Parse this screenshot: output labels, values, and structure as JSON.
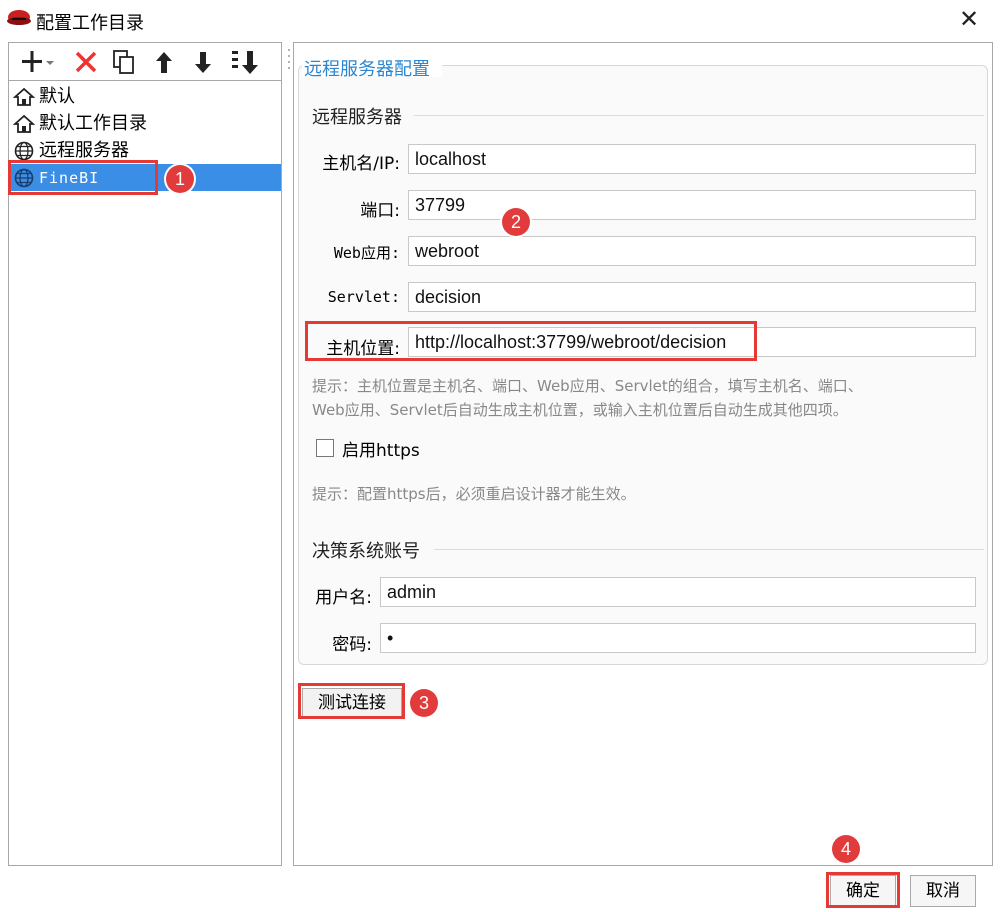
{
  "window": {
    "title": "配置工作目录",
    "close_glyph": "✕"
  },
  "toolbar": {
    "icons": [
      "add-dropdown-icon",
      "delete-icon",
      "copy-icon",
      "arrow-up-icon",
      "arrow-down-icon",
      "sort-icon"
    ]
  },
  "tree": {
    "items": [
      {
        "label": "默认",
        "icon": "home-icon"
      },
      {
        "label": "默认工作目录",
        "icon": "home-icon"
      },
      {
        "label": "远程服务器",
        "icon": "globe-icon"
      },
      {
        "label": "FineBI",
        "icon": "globe-icon",
        "selected": true
      }
    ]
  },
  "panel": {
    "section_title": "远程服务器配置",
    "remote_server_title": "远程服务器",
    "fields": {
      "hostname_label": "主机名/IP:",
      "hostname_value": "localhost",
      "port_label": "端口:",
      "port_value": "37799",
      "webapp_label": "Web应用:",
      "webapp_value": "webroot",
      "servlet_label": "Servlet:",
      "servlet_value": "decision",
      "host_location_label": "主机位置:",
      "host_location_value": "http://localhost:37799/webroot/decision"
    },
    "hint1_line1": "提示：主机位置是主机名、端口、Web应用、Servlet的组合，填写主机名、端口、",
    "hint1_line2": "Web应用、Servlet后自动生成主机位置，或输入主机位置后自动生成其他四项。",
    "https_label": "启用https",
    "https_checked": false,
    "hint2": "提示：配置https后，必须重启设计器才能生效。",
    "account_title": "决策系统账号",
    "username_label": "用户名:",
    "username_value": "admin",
    "password_label": "密码:",
    "password_value": "•",
    "test_button": "测试连接"
  },
  "footer": {
    "ok_button": "确定",
    "cancel_button": "取消"
  },
  "annotations": {
    "badges": [
      "1",
      "2",
      "3",
      "4"
    ],
    "badge_color": "#e23b3b",
    "highlight_color": "#e53935",
    "selection_color": "#3a8ee6",
    "title_color": "#2a86d0"
  }
}
